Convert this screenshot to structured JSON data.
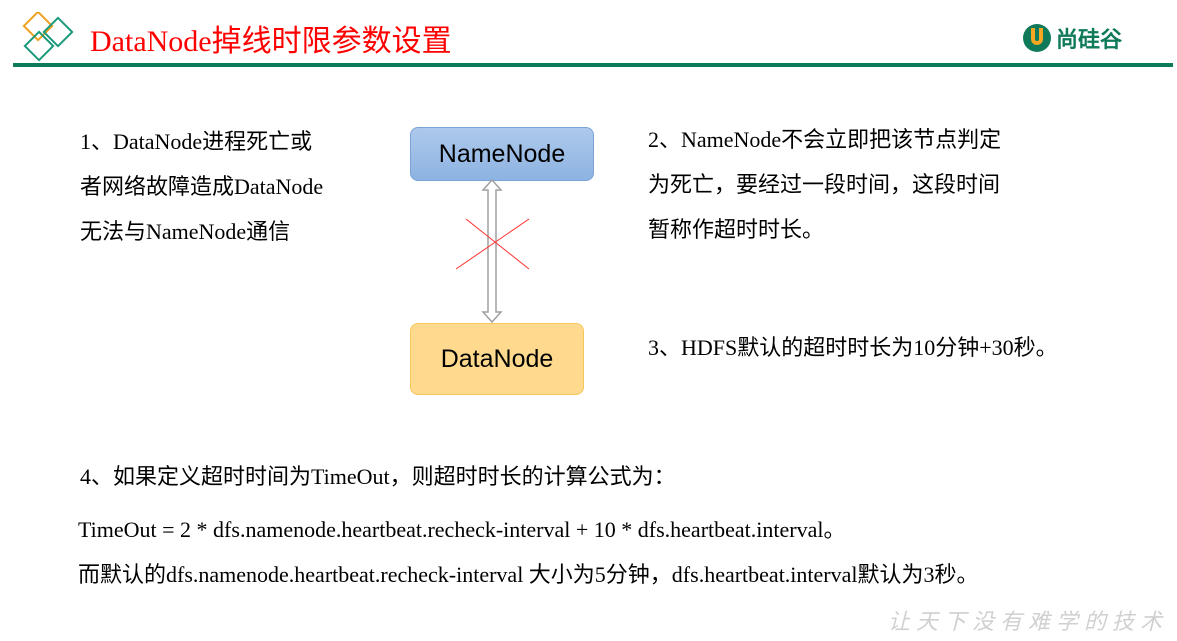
{
  "header": {
    "title": "DataNode掉线时限参数设置",
    "logo_text": "尚硅谷",
    "accent_color": "#0f7a5a",
    "title_color": "#ff0000"
  },
  "left_text": [
    "1、DataNode进程死亡或",
    "者网络故障造成DataNode",
    "无法与NameNode通信"
  ],
  "diagram": {
    "namenode_label": "NameNode",
    "datanode_label": "DataNode"
  },
  "right_text": [
    "2、NameNode不会立即把该节点判定",
    "为死亡，要经过一段时间，这段时间",
    "暂称作超时时长。"
  ],
  "point3": "3、HDFS默认的超时时长为10分钟+30秒。",
  "point4": "4、如果定义超时时间为TimeOut，则超时时长的计算公式为：",
  "formula": "TimeOut  = 2 * dfs.namenode.heartbeat.recheck-interval + 10 * dfs.heartbeat.interval。",
  "defaults": "而默认的dfs.namenode.heartbeat.recheck-interval 大小为5分钟，dfs.heartbeat.interval默认为3秒。",
  "footer": {
    "slogan": "让天下没有难学的技术"
  }
}
